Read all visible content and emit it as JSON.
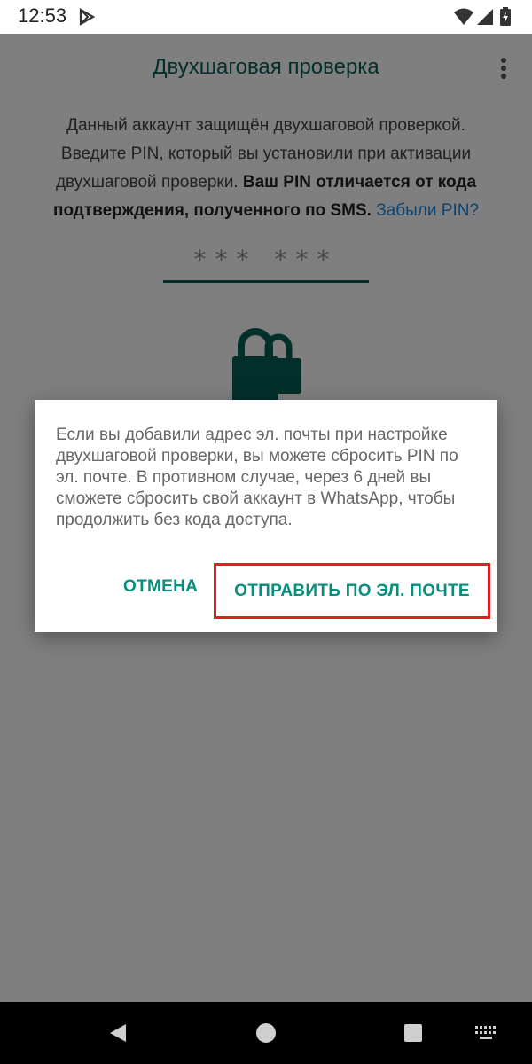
{
  "status_bar": {
    "time": "12:53",
    "icons": [
      "play-store-icon",
      "wifi-icon",
      "signal-icon",
      "battery-charging-icon"
    ]
  },
  "header": {
    "title": "Двухшаговая проверка",
    "menu_icon": "more-vert-icon"
  },
  "description": {
    "text_plain": "Данный аккаунт защищён двухшаговой проверкой. Введите PIN, который вы установили при активации двухшаговой проверки. ",
    "text_bold": "Ваш PIN отличается от кода подтверждения, полученного по SMS.",
    "forgot_link": "Забыли PIN?"
  },
  "pin_input": {
    "placeholder": "*** ***"
  },
  "illustration": {
    "icon": "locks-icon"
  },
  "dialog": {
    "message": "Если вы добавили адрес эл. почты при настройке двухшаговой проверки, вы можете сбросить PIN по эл. почте. В противном случае, через 6 дней вы сможете сбросить свой аккаунт в WhatsApp, чтобы продолжить без кода доступа.",
    "cancel_label": "ОТМЕНА",
    "send_label": "ОТПРАВИТЬ ПО ЭЛ. ПОЧТЕ"
  },
  "nav_bar": {
    "icons": [
      "back-icon",
      "home-icon",
      "recents-icon",
      "keyboard-icon"
    ]
  },
  "colors": {
    "accent": "#075e54",
    "button_text": "#068f7c",
    "link": "#1e88e5",
    "highlight": "#e51c23"
  }
}
